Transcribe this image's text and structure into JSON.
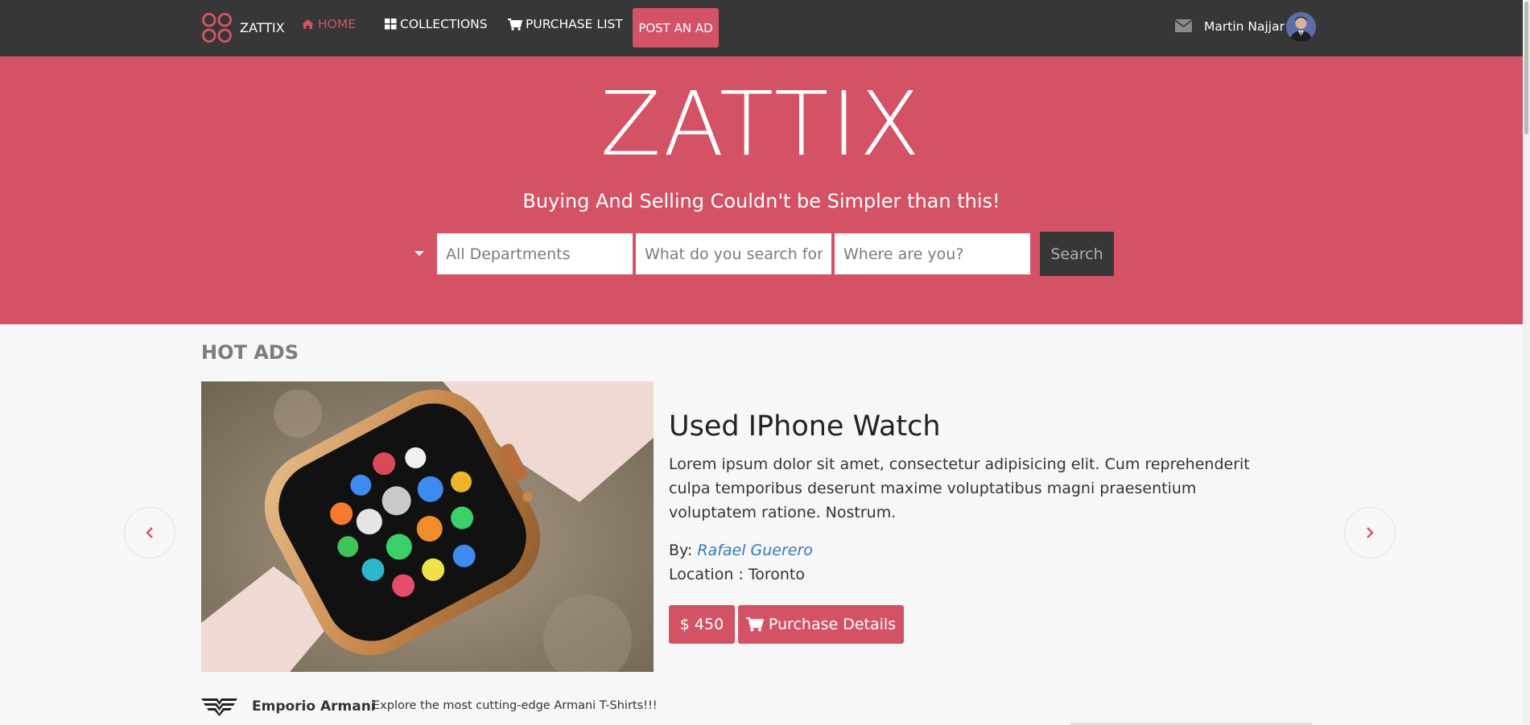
{
  "navbar": {
    "brand": "ZATTIX",
    "items": [
      {
        "label": "HOME",
        "icon": "home-icon",
        "active": true
      },
      {
        "label": "COLLECTIONS",
        "icon": "grid-icon",
        "active": false
      },
      {
        "label": "PURCHASE LIST",
        "icon": "cart-icon",
        "active": false
      }
    ],
    "post_ad_label": "POST AN AD",
    "user_name": "Martin Najjar"
  },
  "hero": {
    "title": "ZATTIX",
    "tagline": "Buying And Selling Couldn't be Simpler than this!",
    "search": {
      "department_placeholder": "All Departments",
      "query_placeholder": "What do you search for?",
      "location_placeholder": "Where are you?",
      "button_label": "Search"
    }
  },
  "hot_ads": {
    "section_title": "HOT ADS",
    "current": {
      "title": "Used IPhone Watch",
      "description": "Lorem ipsum dolor sit amet, consectetur adipisicing elit. Cum reprehenderit culpa temporibus deserunt maxime voluptatibus magni praesentium voluptatem ratione. Nostrum.",
      "by_label": "By:",
      "seller": "Rafael Guerero",
      "location_label": "Location : Toronto",
      "price": "$ 450",
      "purchase_label": "Purchase Details"
    }
  },
  "brand_strip": {
    "name": "Emporio Armani",
    "text": "Explore the most cutting-edge Armani T-Shirts!!!"
  },
  "colors": {
    "accent": "#d45266",
    "nav_bg": "#373737",
    "page_bg": "#f7f7f7"
  }
}
